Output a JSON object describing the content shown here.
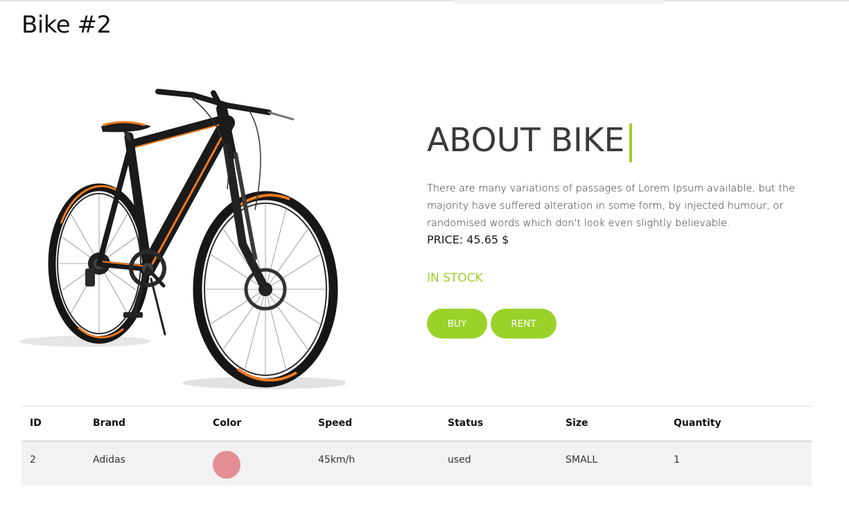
{
  "page": {
    "title": "Bike #2"
  },
  "about": {
    "heading": "ABOUT BIKE",
    "description": "There are many variations of passages of Lorem Ipsum available, but the majority have suffered alteration in some form, by injected humour, or randomised words which don't look even slightly believable.",
    "price": "PRICE: 45.65 $",
    "stock_status": "IN STOCK",
    "buy_label": "BUY",
    "rent_label": "RENT"
  },
  "colors": {
    "accent": "#9bd22a",
    "bike_frame": "#1a1a1a",
    "bike_accent": "#f07a1f"
  },
  "table": {
    "headers": {
      "id": "ID",
      "brand": "Brand",
      "color": "Color",
      "speed": "Speed",
      "status": "Status",
      "size": "Size",
      "quantity": "Quantity"
    },
    "rows": [
      {
        "id": "2",
        "brand": "Adidas",
        "color": "#e28e92",
        "speed": "45km/h",
        "status": "used",
        "size": "SMALL",
        "quantity": "1"
      }
    ]
  }
}
